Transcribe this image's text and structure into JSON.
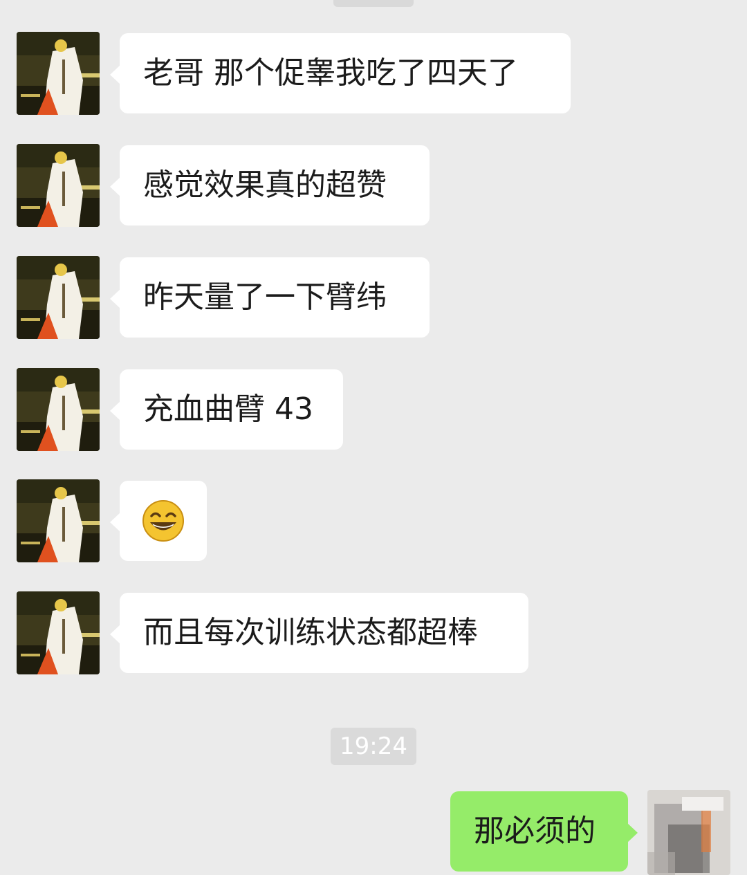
{
  "chat": {
    "messages": [
      {
        "text": "老哥 那个促睾我吃了四天了"
      },
      {
        "text": "感觉效果真的超赞"
      },
      {
        "text": "昨天量了一下臂纬"
      },
      {
        "text": "充血曲臂 43"
      },
      {
        "text": "",
        "icon": "grinning-face-emoji"
      },
      {
        "text": "而且每次训练状态都超棒"
      }
    ],
    "timestamp": "19:24",
    "reply": {
      "text": "那必须的"
    }
  },
  "colors": {
    "background": "#ebebeb",
    "incoming_bubble": "#ffffff",
    "outgoing_bubble": "#95ec69",
    "timestamp_bg": "#dadada"
  }
}
